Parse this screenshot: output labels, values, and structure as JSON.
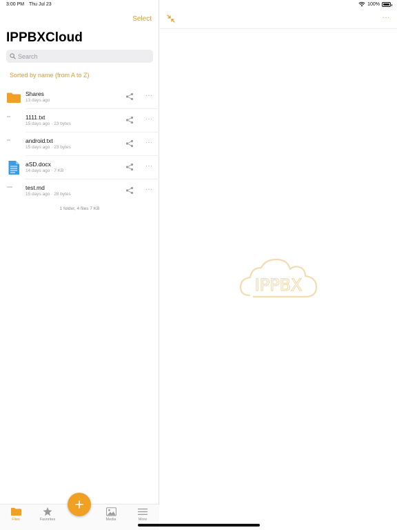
{
  "status_bar": {
    "time": "3:00 PM",
    "date": "Thu Jul 23",
    "battery_text": "100%",
    "battery_level": 1.0
  },
  "sidebar": {
    "select_label": "Select",
    "title": "IPPBXCloud",
    "search_placeholder": "Search",
    "sort_label": "Sorted by name (from A to Z)",
    "files": [
      {
        "name": "Shares",
        "meta": "13 days ago",
        "icon": "folder-icon"
      },
      {
        "name": "1111.txt",
        "meta": "15 days ago · 23 bytes",
        "icon": "text-file-icon"
      },
      {
        "name": "android.txt",
        "meta": "15 days ago · 23 bytes",
        "icon": "text-file-icon"
      },
      {
        "name": "aSD.docx",
        "meta": "14 days ago · 7 KB",
        "icon": "document-icon"
      },
      {
        "name": "test.md",
        "meta": "15 days ago · 28 bytes",
        "icon": "text-file-icon"
      }
    ],
    "summary": "1 folder, 4 files 7 KB",
    "more_glyph": "···"
  },
  "tabs": [
    {
      "label": "Files",
      "icon": "folder-icon",
      "active": true
    },
    {
      "label": "Favorites",
      "icon": "star-icon",
      "active": false
    },
    {
      "label": "Media",
      "icon": "image-icon",
      "active": false
    },
    {
      "label": "More",
      "icon": "menu-icon",
      "active": false
    }
  ],
  "detail": {
    "more_glyph": "···",
    "logo_text": "IPPBX"
  },
  "colors": {
    "accent": "#e39a1c",
    "fab": "#f0a023",
    "folder": "#f0a023",
    "doc": "#3d9be0",
    "logo": "#f3dcb0"
  }
}
